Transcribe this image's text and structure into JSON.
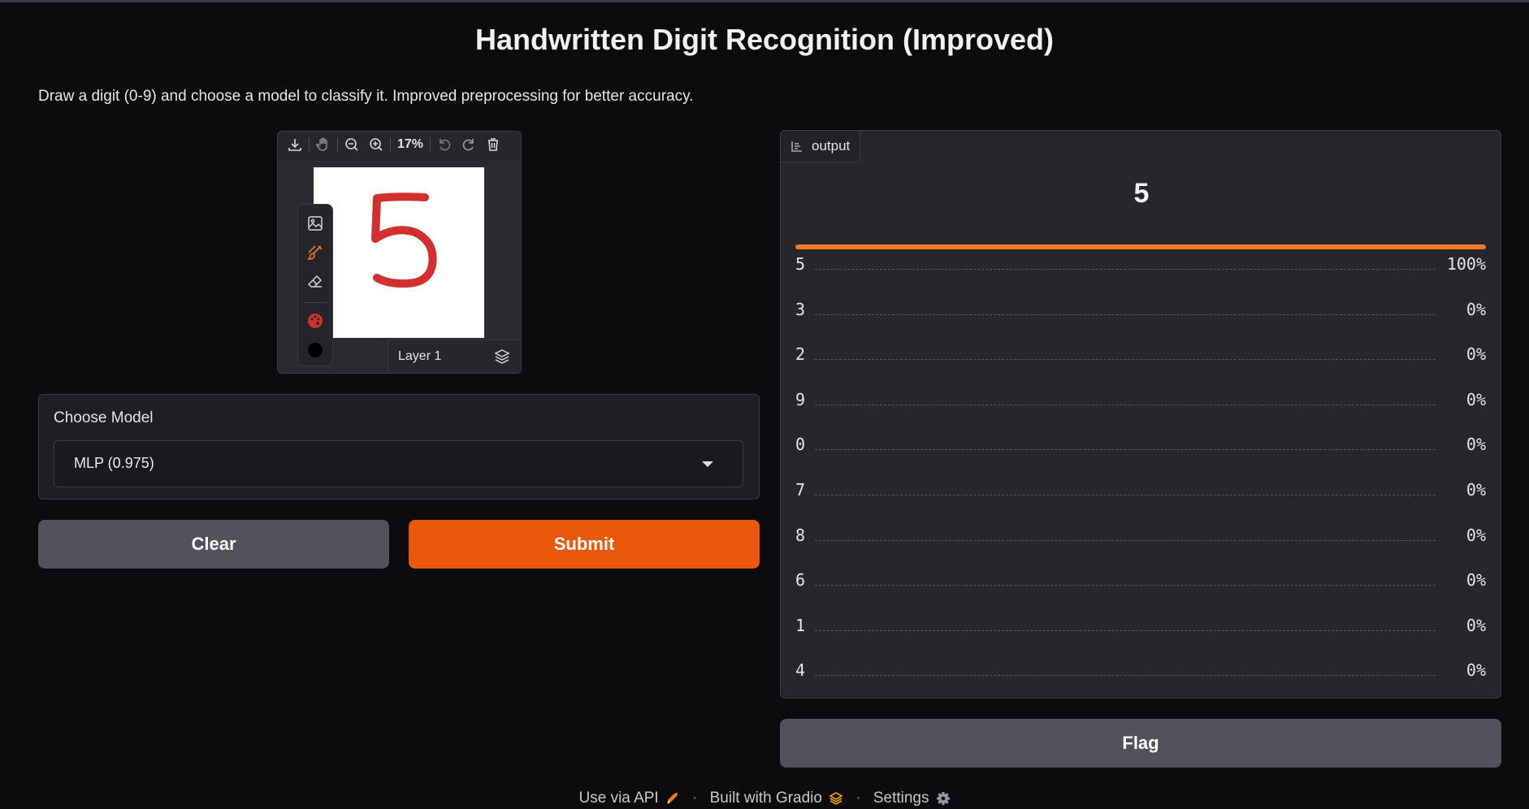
{
  "app": {
    "title": "Handwritten Digit Recognition (Improved)",
    "description": "Draw a digit (0-9) and choose a model to classify it. Improved preprocessing for better accuracy."
  },
  "editor": {
    "zoom": "17%",
    "layer_label": "Layer 1",
    "drawn_digit": "5",
    "brush_color": "#d03030"
  },
  "model": {
    "label": "Choose Model",
    "selected": "MLP (0.975)"
  },
  "buttons": {
    "clear": "Clear",
    "submit": "Submit",
    "flag": "Flag"
  },
  "output": {
    "tab_label": "output",
    "top_label": "5",
    "confidences": [
      {
        "label": "5",
        "percent": "100%",
        "value": 1.0
      },
      {
        "label": "3",
        "percent": "0%",
        "value": 0.0
      },
      {
        "label": "2",
        "percent": "0%",
        "value": 0.0
      },
      {
        "label": "9",
        "percent": "0%",
        "value": 0.0
      },
      {
        "label": "0",
        "percent": "0%",
        "value": 0.0
      },
      {
        "label": "7",
        "percent": "0%",
        "value": 0.0
      },
      {
        "label": "8",
        "percent": "0%",
        "value": 0.0
      },
      {
        "label": "6",
        "percent": "0%",
        "value": 0.0
      },
      {
        "label": "1",
        "percent": "0%",
        "value": 0.0
      },
      {
        "label": "4",
        "percent": "0%",
        "value": 0.0
      }
    ]
  },
  "footer": {
    "api": "Use via API",
    "built": "Built with Gradio",
    "settings": "Settings",
    "separator": "·"
  },
  "colors": {
    "accent": "#ea580c",
    "bar": "#f07a2c",
    "background": "#0c0c0f",
    "panel": "#26262b"
  }
}
